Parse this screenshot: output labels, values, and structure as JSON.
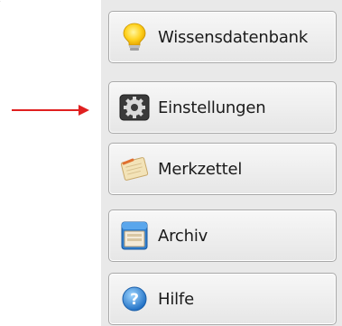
{
  "corner_mark": ".",
  "nav": {
    "items": [
      {
        "label": "Wissensdatenbank",
        "icon": "lightbulb-icon"
      },
      {
        "label": "Einstellungen",
        "icon": "gear-icon"
      },
      {
        "label": "Merkzettel",
        "icon": "notepad-icon"
      },
      {
        "label": "Archiv",
        "icon": "archive-drawer-icon"
      },
      {
        "label": "Hilfe",
        "icon": "help-icon"
      }
    ]
  },
  "annotation": {
    "arrow_color": "#e02020",
    "points_to": "Einstellungen"
  }
}
